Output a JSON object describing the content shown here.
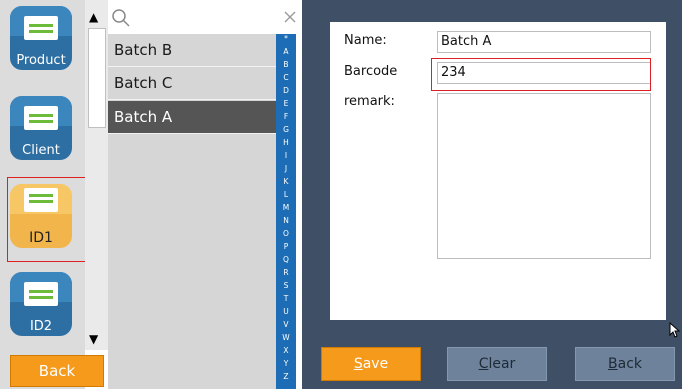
{
  "sidebar": {
    "items": [
      {
        "label": "Product",
        "icon": "envelope-icon",
        "color": "blue"
      },
      {
        "label": "Client",
        "icon": "envelope-icon",
        "color": "blue"
      },
      {
        "label": "ID1",
        "icon": "open-envelope-icon",
        "color": "orange",
        "selected": true
      },
      {
        "label": "ID2",
        "icon": "envelope-icon",
        "color": "blue"
      }
    ],
    "back_label": "Back"
  },
  "search": {
    "icon": "search-icon",
    "clear_icon": "close-icon"
  },
  "list": {
    "items": [
      {
        "label": "Batch B"
      },
      {
        "label": "Batch C"
      },
      {
        "label": "Batch A",
        "selected": true
      }
    ]
  },
  "alphabet": [
    "*",
    "A",
    "B",
    "C",
    "D",
    "E",
    "F",
    "G",
    "H",
    "I",
    "J",
    "K",
    "L",
    "M",
    "N",
    "O",
    "P",
    "Q",
    "R",
    "S",
    "T",
    "U",
    "V",
    "W",
    "X",
    "Y",
    "Z"
  ],
  "form": {
    "name_label": "Name:",
    "name_value": "Batch A",
    "barcode_label": "Barcode",
    "barcode_value": "234",
    "remark_label": "remark:",
    "remark_value": ""
  },
  "buttons": {
    "save": {
      "label": "Save",
      "mnemonic": "S",
      "rest": "ave"
    },
    "clear": {
      "label": "Clear",
      "mnemonic": "C",
      "rest": "lear"
    },
    "back": {
      "label": "Back",
      "mnemonic": "B",
      "rest": "ack"
    }
  },
  "colors": {
    "accent_orange": "#f59a1b",
    "alphabet_blue": "#1d6db6",
    "panel_bg": "#3f5066",
    "highlight_red": "#e02020"
  }
}
